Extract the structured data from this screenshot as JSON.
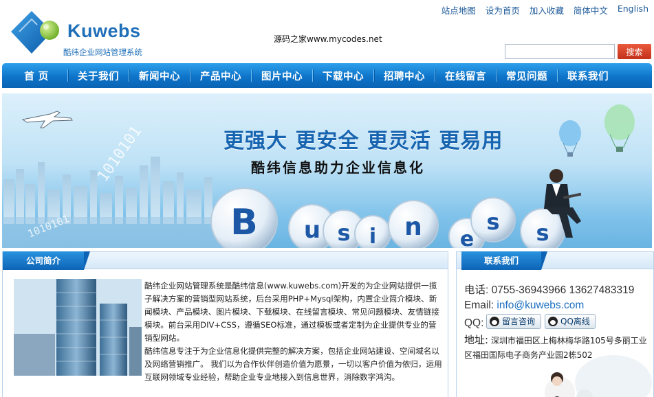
{
  "header": {
    "logo_text": "Kuwebs",
    "logo_subtitle": "酷纬企业网站管理系统",
    "watermark": "源码之家www.mycodes.net",
    "top_links": [
      "站点地图",
      "设为首页",
      "加入收藏",
      "简体中文",
      "English"
    ],
    "search_placeholder": "",
    "search_button": "搜索"
  },
  "nav": {
    "items": [
      "首 页",
      "关于我们",
      "新闻中心",
      "产品中心",
      "图片中心",
      "下载中心",
      "招聘中心",
      "在线留言",
      "常见问题",
      "联系我们"
    ]
  },
  "banner": {
    "headline": "更强大 更安全 更灵活 更易用",
    "subline": "酷纬信息助力企业信息化",
    "ball_letters": [
      "B",
      "u",
      "s",
      "i",
      "n",
      "e",
      "s",
      "s"
    ]
  },
  "about": {
    "title": "公司简介",
    "paragraph1": "酷纬企业网站管理系统是酷纬信息(www.kuwebs.com)开发的为企业网站提供一揽子解决方案的营销型网站系统，后台采用PHP+Mysql架构，内置企业简介模块、新闻模块、产品模块、图片模块、下载模块、在线留言模块、常见问题模块、友情链接模块。前台采用DIV+CSS，遵循SEO标准，通过模板或者定制为企业提供专业的营销型网站。",
    "paragraph2": "酷纬信息专注于为企业信息化提供完整的解决方案，包括企业网站建设、空间域名以及网络营销推广。 我们以为合作伙伴创造价值为愿景，一切以客户价值为依归，运用互联网领域专业经验，帮助企业专业地接入到信息世界，消除数字鸿沟。"
  },
  "contact": {
    "title": "联系我们",
    "phone": "电话: 0755-36943966 13627483319",
    "email_label": "Email: ",
    "email": "info@kuwebs.com",
    "qq_label": "QQ:",
    "qq_consult": "留言咨询",
    "qq_offline": "QQ离线",
    "address_label": "地址:",
    "address": "深圳市福田区上梅林梅华路105号多丽工业区福田国际电子商务产业园2栋502"
  },
  "colors": {
    "nav_blue": "#0e74c9",
    "brand_blue": "#1f6fb8",
    "search_red": "#d5401f",
    "logo_green": "#8cc63f"
  }
}
